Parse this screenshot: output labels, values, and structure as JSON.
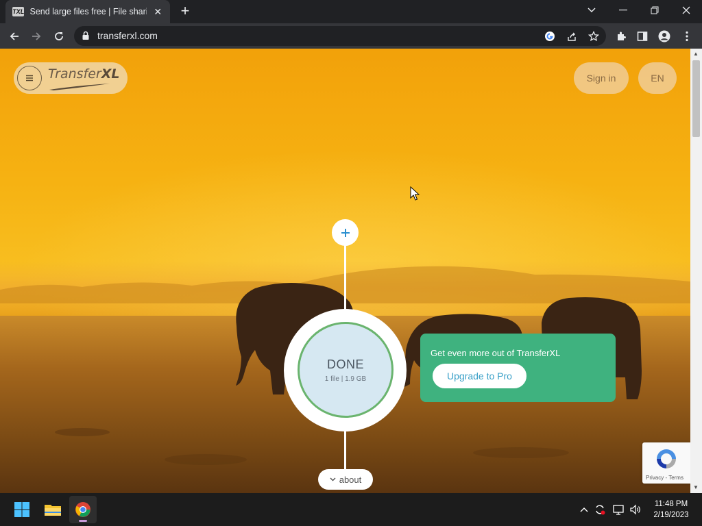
{
  "browser": {
    "tab": {
      "favicon_text": "TXL",
      "title": "Send large files free | File sharing"
    },
    "url": "transferxl.com"
  },
  "site": {
    "logo": {
      "text_light": "Transfer",
      "text_bold": "XL"
    },
    "sign_in_label": "Sign in",
    "language_label": "EN",
    "transfer": {
      "status": "DONE",
      "summary": "1 file | 1.9 GB"
    },
    "promo": {
      "title": "Get even more out of TransferXL",
      "button_label": "Upgrade to Pro"
    },
    "about_label": "about",
    "recaptcha_links": "Privacy - Terms"
  },
  "taskbar": {
    "time": "11:48 PM",
    "date": "2/19/2023"
  },
  "colors": {
    "promo_green": "#3fb27f",
    "plus_blue": "#2a8fcf",
    "done_circle_fill": "#d6e8f2",
    "done_circle_ring": "#6ab46e"
  }
}
